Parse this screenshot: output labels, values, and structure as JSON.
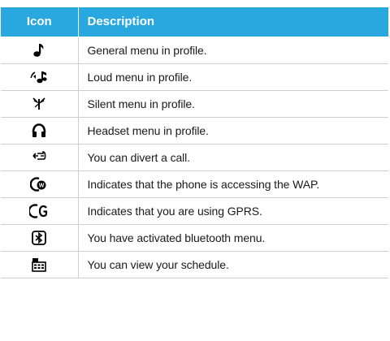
{
  "table": {
    "header": {
      "icon": "Icon",
      "description": "Description"
    },
    "rows": [
      {
        "icon": "music-note-icon",
        "description": "General menu in profile."
      },
      {
        "icon": "loud-speaker-note-icon",
        "description": "Loud menu in profile."
      },
      {
        "icon": "silent-antenna-icon",
        "description": "Silent menu in profile."
      },
      {
        "icon": "headset-icon",
        "description": "Headset menu in profile."
      },
      {
        "icon": "call-divert-icon",
        "description": "You can divert a call."
      },
      {
        "icon": "wap-icon",
        "description": "Indicates that the phone is accessing the WAP."
      },
      {
        "icon": "gprs-icon",
        "description": "Indicates that you are using GPRS."
      },
      {
        "icon": "bluetooth-icon",
        "description": "You have activated bluetooth menu."
      },
      {
        "icon": "schedule-icon",
        "description": "You can view your schedule."
      }
    ],
    "colors": {
      "header_bg": "#29a8e0",
      "header_text": "#ffffff",
      "grid": "#cfcfcf"
    }
  }
}
